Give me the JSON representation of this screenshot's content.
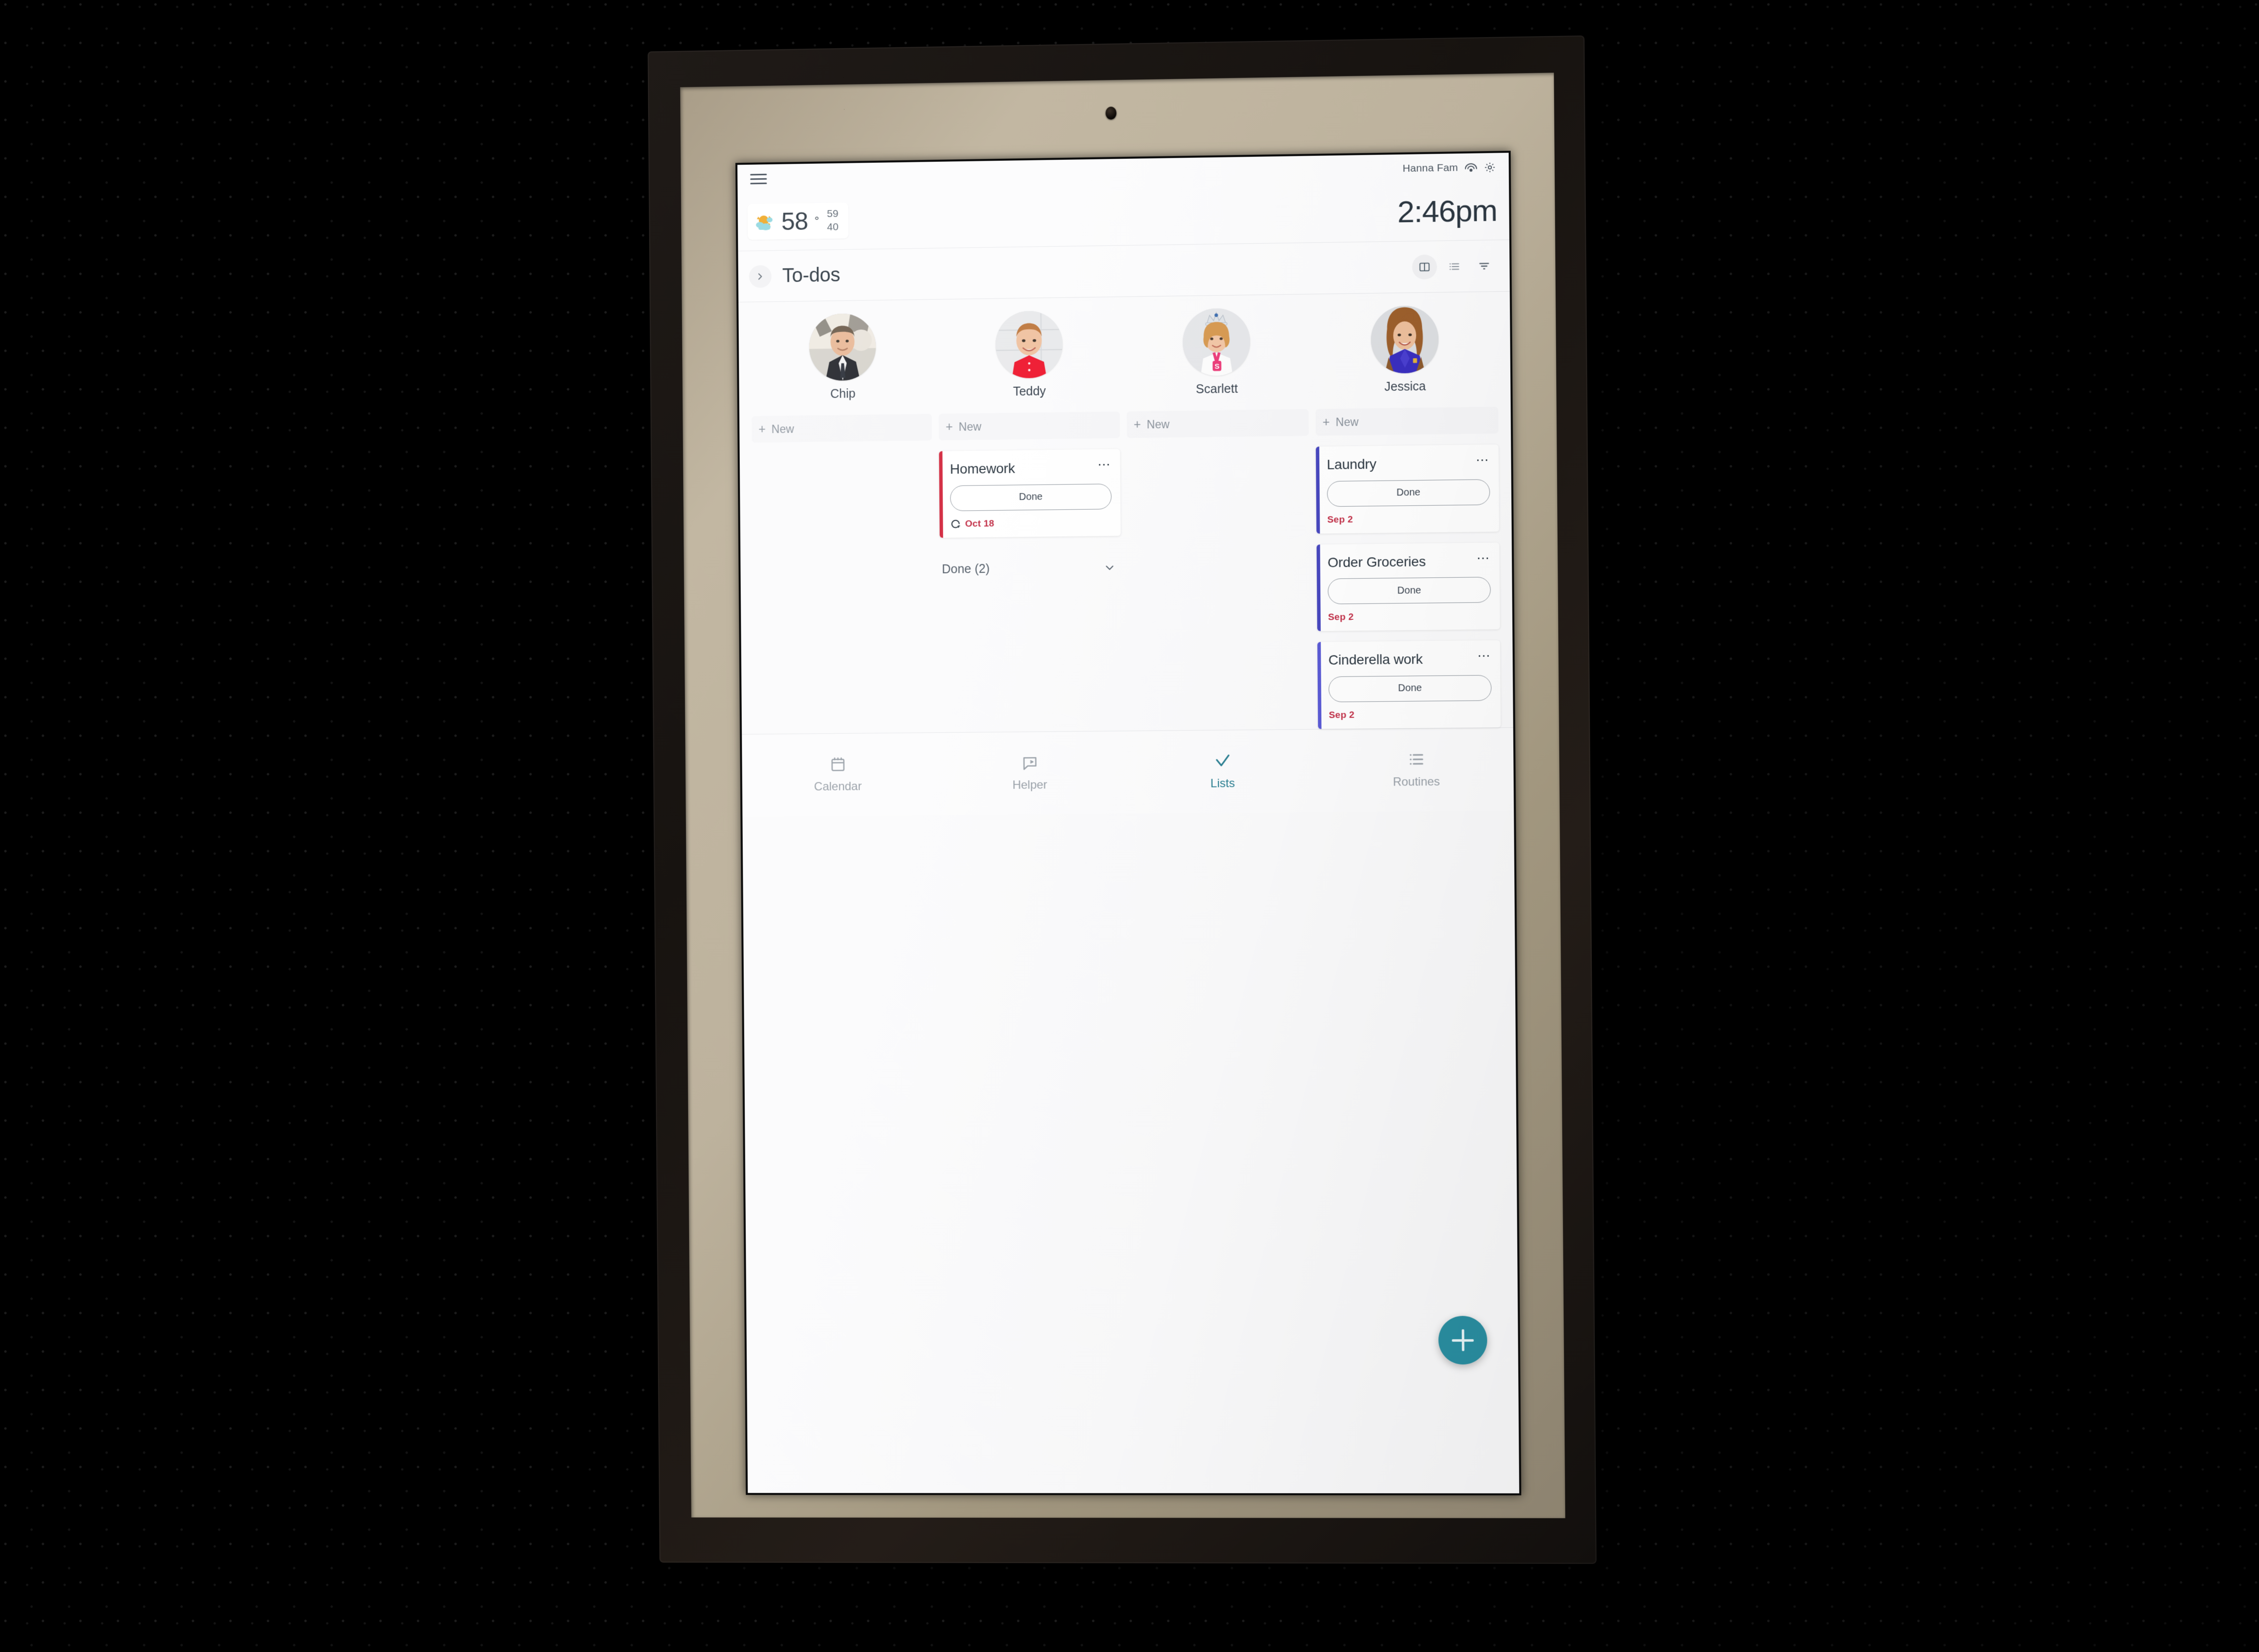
{
  "device": {
    "camera_icon": "camera-dot"
  },
  "status": {
    "menu_icon": "hamburger-menu-icon",
    "family_name": "Hanna Fam",
    "wifi_icon": "wifi-icon",
    "settings_icon": "gear-icon"
  },
  "topbar": {
    "weather": {
      "icon": "partly-cloudy-icon",
      "temp": "58",
      "degree": "°",
      "high": "59",
      "low": "40"
    },
    "clock": "2:46pm"
  },
  "page": {
    "back_icon": "chevron-right-icon",
    "title": "To-dos",
    "tools": [
      {
        "icon": "board-view-icon",
        "name": "board-view",
        "active": true
      },
      {
        "icon": "list-view-icon",
        "name": "list-view",
        "active": false
      },
      {
        "icon": "filter-icon",
        "name": "filter",
        "active": false
      }
    ]
  },
  "people": [
    {
      "name": "Chip"
    },
    {
      "name": "Teddy"
    },
    {
      "name": "Scarlett"
    },
    {
      "name": "Jessica"
    }
  ],
  "new_button_label": "New",
  "new_button_plus": "+",
  "columns": [
    {
      "owner": "Chip",
      "cards": [],
      "done_group": null
    },
    {
      "owner": "Teddy",
      "cards": [
        {
          "title": "Homework",
          "accent": "#d32a40",
          "action_label": "Done",
          "date": "Oct 18",
          "repeat": true,
          "menu_icon": "more-options-icon"
        }
      ],
      "done_group": {
        "label": "Done (2)",
        "chevron_icon": "chevron-down-icon"
      }
    },
    {
      "owner": "Scarlett",
      "cards": [],
      "done_group": null
    },
    {
      "owner": "Jessica",
      "cards": [
        {
          "title": "Laundry",
          "accent": "#4747bf",
          "action_label": "Done",
          "date": "Sep 2",
          "repeat": false,
          "menu_icon": "more-options-icon"
        },
        {
          "title": "Order Groceries",
          "accent": "#4747bf",
          "action_label": "Done",
          "date": "Sep 2",
          "repeat": false,
          "menu_icon": "more-options-icon"
        },
        {
          "title": "Cinderella work",
          "accent": "#5b5bd6",
          "action_label": "Done",
          "date": "Sep 2",
          "repeat": false,
          "menu_icon": "more-options-icon"
        }
      ],
      "done_group": null
    }
  ],
  "fab": {
    "icon": "plus-icon"
  },
  "bottom_nav": [
    {
      "label": "Calendar",
      "icon": "calendar-icon",
      "active": false
    },
    {
      "label": "Helper",
      "icon": "helper-chat-icon",
      "active": false
    },
    {
      "label": "Lists",
      "icon": "check-icon",
      "active": true
    },
    {
      "label": "Routines",
      "icon": "list-icon",
      "active": false
    }
  ],
  "colors": {
    "accent_teal": "#2a8fa2",
    "date_red": "#c23048",
    "card_red": "#d32a40",
    "card_indigo": "#4747bf",
    "text_dark": "#2b3640"
  }
}
